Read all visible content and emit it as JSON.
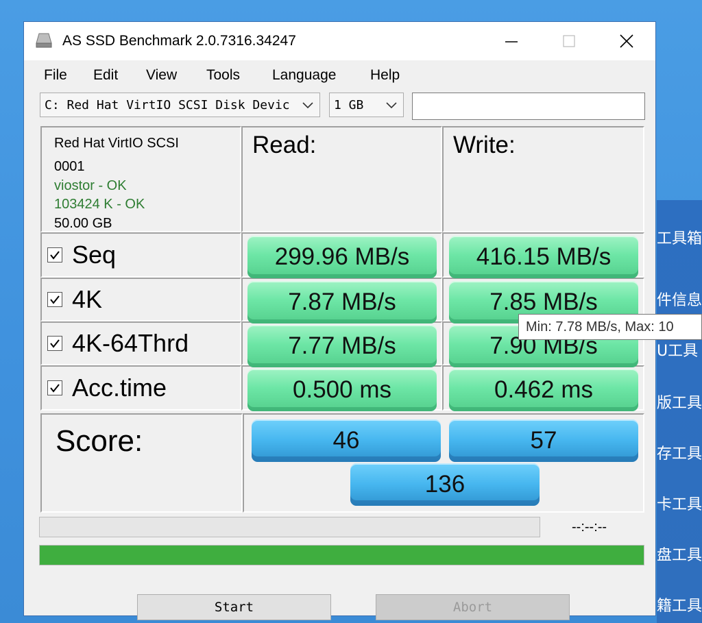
{
  "window": {
    "title": "AS SSD Benchmark 2.0.7316.34247"
  },
  "menu": [
    "File",
    "Edit",
    "View",
    "Tools",
    "Language",
    "Help"
  ],
  "drive_select": {
    "value": "C: Red Hat VirtIO SCSI Disk Devic"
  },
  "size_select": {
    "value": "1 GB"
  },
  "device_info": {
    "name": "Red Hat VirtIO SCSI",
    "id": "0001",
    "driver": "viostor - OK",
    "alignment": "103424 K - OK",
    "capacity": "50.00 GB"
  },
  "headers": {
    "read": "Read:",
    "write": "Write:"
  },
  "rows": [
    {
      "label": "Seq",
      "read": "299.96 MB/s",
      "write": "416.15 MB/s"
    },
    {
      "label": "4K",
      "read": "7.87 MB/s",
      "write": "7.85 MB/s"
    },
    {
      "label": "4K-64Thrd",
      "read": "7.77 MB/s",
      "write": "7.90 MB/s"
    },
    {
      "label": "Acc.time",
      "read": "0.500 ms",
      "write": "0.462 ms"
    }
  ],
  "score": {
    "label": "Score:",
    "read": "46",
    "write": "57",
    "total": "136"
  },
  "tooltip": "Min: 7.78 MB/s, Max: 10",
  "time_text": "--:--:--",
  "progress": {
    "top_fraction": 0.0,
    "bottom_fraction": 1.0,
    "bar_color": "#3fae3f"
  },
  "buttons": {
    "start": "Start",
    "abort": "Abort"
  },
  "background_panel": [
    "工具箱",
    "件信息",
    "U工具",
    "版工具",
    "存工具",
    "卡工具",
    "盘工具",
    "籍工具"
  ],
  "colors": {
    "ok_text": "#2e7d32",
    "read_write_box": "#6de6a6",
    "score_box": "#46b6ef"
  }
}
